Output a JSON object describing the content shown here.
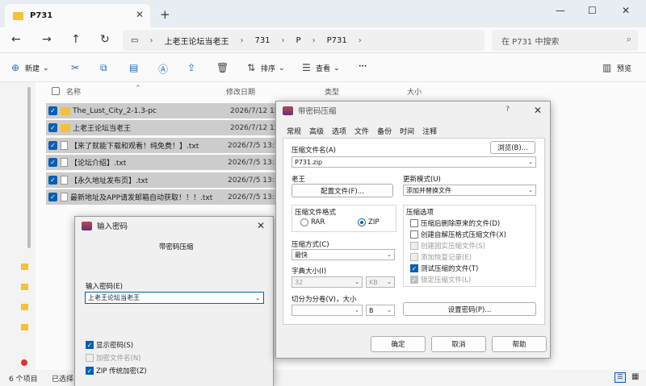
{
  "tab": {
    "title": "P731"
  },
  "address": {
    "crumbs": [
      "上老王论坛当老王",
      "731",
      "P",
      "P731"
    ],
    "search_placeholder": "在 P731 中搜索"
  },
  "toolbar": {
    "new_label": "新建",
    "sort_label": "排序",
    "view_label": "查看",
    "more_label": "···",
    "preview_label": "预览"
  },
  "columns": {
    "name": "名称",
    "date": "修改日期",
    "type": "类型",
    "size": "大小"
  },
  "files": [
    {
      "name": "The_Lust_City_2-1.3-pc",
      "date": "2026/7/12 15"
    },
    {
      "name": "上老王论坛当老王",
      "date": "2026/7/12 15"
    },
    {
      "name": "【来了就能下载和观看！纯免费！】.txt",
      "date": "2026/7/5 13:1"
    },
    {
      "name": "【论坛介绍】.txt",
      "date": "2026/7/5 13:1"
    },
    {
      "name": "【永久地址发布页】.txt",
      "date": "2026/7/5 13:1"
    },
    {
      "name": "最新地址及APP请发邮箱自动获取！！！.txt",
      "date": "2026/7/5 13:1"
    }
  ],
  "status": {
    "count": "6 个项目",
    "selected": "已选择"
  },
  "pwd_dialog": {
    "title": "输入密码",
    "subtitle": "带密码压缩",
    "input_label": "输入密码(E)",
    "input_value": "上老王论坛当老王",
    "opt_show": "显示密码(S)",
    "opt_encrypt_names": "加密文件名(N)",
    "opt_zip_legacy": "ZIP 传统加密(Z)"
  },
  "arc_dialog": {
    "title": "带密码压缩",
    "help_glyph": "?",
    "tabs": [
      "常规",
      "高级",
      "选项",
      "文件",
      "备份",
      "时间",
      "注释"
    ],
    "archive_name_label": "压缩文件名(A)",
    "archive_name": "P731.zip",
    "browse_btn": "浏览(B)...",
    "profile_label": "老王",
    "config_btn": "配置文件(F)...",
    "update_label": "更新模式(U)",
    "update_value": "添加并替换文件",
    "format_label": "压缩文件格式",
    "format_rar": "RAR",
    "format_zip": "ZIP",
    "method_label": "压缩方式(C)",
    "method_value": "最快",
    "dict_label": "字典大小(I)",
    "dict_value": "32",
    "dict_unit": "KB",
    "split_label": "切分为分卷(V)，大小",
    "split_unit": "B",
    "options_label": "压缩选项",
    "options": [
      {
        "label": "压缩后删除原来的文件(D)",
        "checked": false,
        "disabled": false
      },
      {
        "label": "创建自解压格式压缩文件(X)",
        "checked": false,
        "disabled": false
      },
      {
        "label": "创建固实压缩文件(S)",
        "checked": false,
        "disabled": true
      },
      {
        "label": "添加恢复记录(E)",
        "checked": false,
        "disabled": true
      },
      {
        "label": "测试压缩的文件(T)",
        "checked": true,
        "disabled": false
      },
      {
        "label": "锁定压缩文件(L)",
        "checked": true,
        "disabled": true
      }
    ],
    "set_pwd_btn": "设置密码(P)...",
    "ok_btn": "确定",
    "cancel_btn": "取消",
    "help_btn": "帮助"
  },
  "colors": {
    "accent": "#0a5fb0",
    "folder": "#f3c13a",
    "selected_row": "#cccccc"
  }
}
